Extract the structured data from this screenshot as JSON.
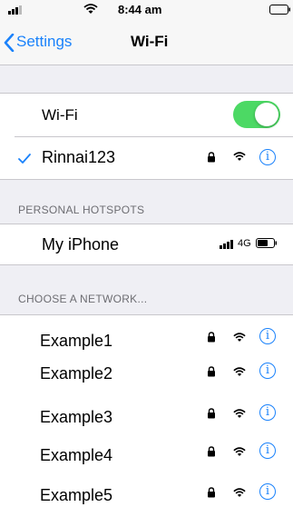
{
  "status_bar": {
    "time": "8:44 am"
  },
  "nav": {
    "back_label": "Settings",
    "title": "Wi-Fi"
  },
  "wifi_toggle": {
    "label": "Wi-Fi",
    "on": true
  },
  "connected_network": {
    "name": "Rinnai123"
  },
  "hotspots": {
    "header": "PERSONAL HOTSPOTS",
    "items": [
      {
        "name": "My iPhone",
        "network_type": "4G"
      }
    ]
  },
  "networks": {
    "header": "CHOOSE A NETWORK...",
    "items": [
      {
        "name": "Example1"
      },
      {
        "name": "Example2"
      },
      {
        "name": "Example3"
      },
      {
        "name": "Example4"
      },
      {
        "name": "Example5"
      }
    ]
  },
  "colors": {
    "accent": "#1a82fb",
    "toggle_on": "#4cd964",
    "background": "#efeff4",
    "separator": "#c8c7cc"
  },
  "icons": [
    "signal-icon",
    "wifi-icon",
    "battery-icon",
    "back-chevron-icon",
    "checkmark-icon",
    "lock-icon",
    "info-icon"
  ]
}
